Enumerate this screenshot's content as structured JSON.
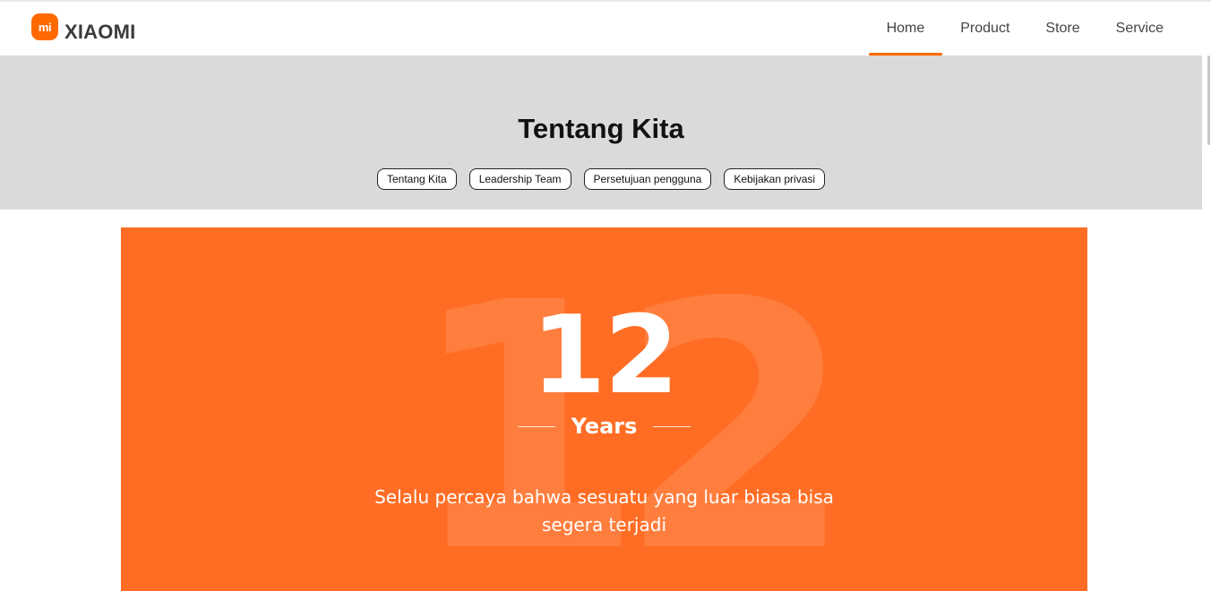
{
  "brand": {
    "name": "XIAOMI",
    "logo_text": "mi",
    "logo_icon": "mi-logo-icon",
    "accent": "#ff6900"
  },
  "nav": {
    "items": [
      "Home",
      "Product",
      "Store",
      "Service"
    ],
    "active": "Home"
  },
  "hero": {
    "title": "Tentang Kita",
    "tabs": [
      "Tentang Kita",
      "Leadership Team",
      "Persetujuan pengguna",
      "Kebijakan privasi"
    ]
  },
  "banner": {
    "background_number": "12",
    "number": "12",
    "unit": "Years",
    "tagline_line1": "Selalu percaya bahwa sesuatu yang luar biasa bisa",
    "tagline_line2": "segera terjadi",
    "color": "#ff6d24"
  }
}
